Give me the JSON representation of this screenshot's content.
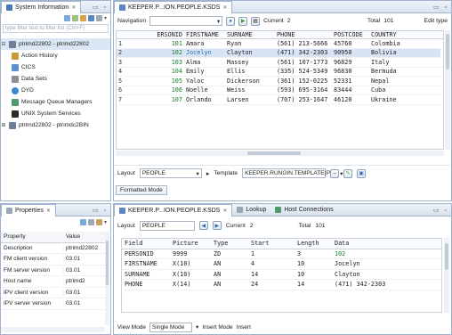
{
  "sysinfo": {
    "tab_label": "System Information",
    "filter_placeholder": "type filter text to filter list (Ctrl+F)",
    "tree": [
      {
        "label": "ptrimd22802 - ptrimd22802",
        "icon": "server-icon",
        "selected": true,
        "indent": 0
      },
      {
        "label": "Action History",
        "icon": "history-icon",
        "indent": 1
      },
      {
        "label": "CICS",
        "icon": "cics-icon",
        "indent": 1
      },
      {
        "label": "Data Sets",
        "icon": "datasets-icon",
        "indent": 1
      },
      {
        "label": "DYD",
        "icon": "globe-icon",
        "indent": 1
      },
      {
        "label": "Message Queue Managers",
        "icon": "queue-icon",
        "indent": 1
      },
      {
        "label": "UNIX System Services",
        "icon": "unix-icon",
        "indent": 1
      },
      {
        "label": "ptrimd22802 - ptrimdc2BIN",
        "icon": "server-icon",
        "indent": 0
      }
    ]
  },
  "editor": {
    "tab_label": "KEEPER.P...ION.PEOPLE.KSDS",
    "navigation_label": "Navigation",
    "current_label": "Current",
    "current_value": "2",
    "total_label": "Total",
    "total_value": "101",
    "edit_type_label": "Edit type",
    "columns": [
      "",
      "PERSONID",
      "FIRSTNAME",
      "SURNAME",
      "PHONE",
      "POSTCODE",
      "COUNTRY"
    ],
    "rows": [
      [
        "1",
        "101",
        "Amara",
        "Ryan",
        "(561) 213-5666",
        "45760",
        "Colombia"
      ],
      [
        "2",
        "102",
        "Jocelyn",
        "Clayton",
        "(471) 342-2303",
        "90950",
        "Bolivia"
      ],
      [
        "3",
        "103",
        "Alma",
        "Massey",
        "(561) 107-1773",
        "96829",
        "Italy"
      ],
      [
        "4",
        "104",
        "Emily",
        "Ellis",
        "(335) 524-5349",
        "96830",
        "Bermuda"
      ],
      [
        "5",
        "105",
        "Yaloc",
        "Dickerson",
        "(361) 152-0225",
        "52331",
        "Nepal"
      ],
      [
        "6",
        "106",
        "Noelle",
        "Weiss",
        "(593) 695-3164",
        "83444",
        "Cuba"
      ],
      [
        "7",
        "107",
        "Orlando",
        "Larsen",
        "(707) 253-1647",
        "46120",
        "Ukraine"
      ]
    ],
    "selected_row": 1,
    "layout_label": "Layout",
    "layout_value": "PEOPLE",
    "template_label": "Template",
    "template_value": "KEEPER.RUNGIN.TEMPLATE(PEC",
    "formatted_mode_label": "Formatted Mode"
  },
  "properties": {
    "tab_label": "Properties",
    "col_property": "Property",
    "col_value": "Value",
    "rows": [
      [
        "Description",
        "ptrimd22802"
      ],
      [
        "FM client version",
        "03.01"
      ],
      [
        "FM server version",
        "03.01"
      ],
      [
        "Host name",
        "ptrimd2"
      ],
      [
        "IPV client version",
        "03.01"
      ],
      [
        "IPV server version",
        "03.01"
      ]
    ]
  },
  "record": {
    "tabs": [
      "KEEPER.P...ION.PEOPLE.KSDS",
      "Lookup",
      "Host Connections"
    ],
    "layout_label": "Layout",
    "layout_value": "PEOPLE",
    "current_label": "Current",
    "current_value": "2",
    "total_label": "Total",
    "total_value": "101",
    "columns": [
      "Field",
      "Picture",
      "Type",
      "Start",
      "Length",
      "Data"
    ],
    "rows": [
      [
        "PERSONID",
        "9999",
        "ZD",
        "1",
        "3",
        "102"
      ],
      [
        "FIRSTNAME",
        "X(10)",
        "AN",
        "4",
        "10",
        "Jocelyn"
      ],
      [
        "SURNAME",
        "X(10)",
        "AN",
        "14",
        "10",
        "Clayton"
      ],
      [
        "PHONE",
        "X(14)",
        "AN",
        "24",
        "14",
        "(471) 342-2303"
      ]
    ],
    "view_mode_label": "View Mode",
    "view_mode_value": "Single Mode",
    "insert_mode_label": "Insert Mode",
    "insert_mode_value": "Insert"
  }
}
